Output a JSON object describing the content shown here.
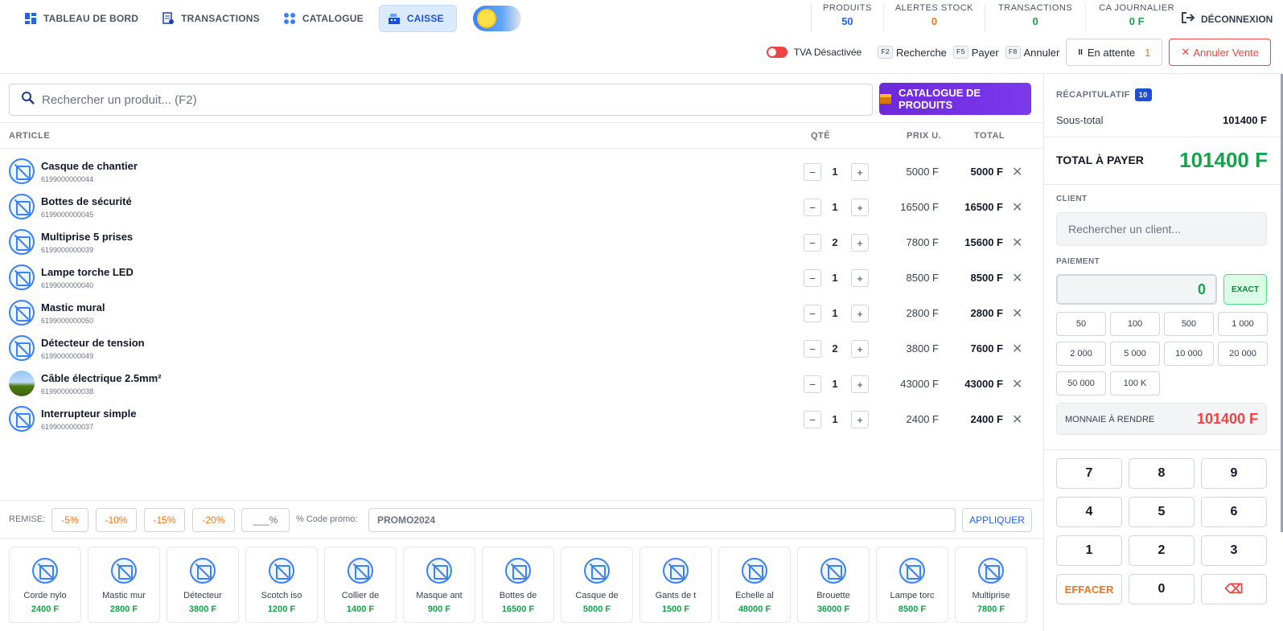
{
  "nav": {
    "items": [
      {
        "label": "TABLEAU DE BORD",
        "icon": "dashboard-icon"
      },
      {
        "label": "TRANSACTIONS",
        "icon": "receipt-icon"
      },
      {
        "label": "CATALOGUE",
        "icon": "grid-icon"
      },
      {
        "label": "CAISSE",
        "icon": "register-icon"
      }
    ]
  },
  "stats": [
    {
      "label": "PRODUITS",
      "value": "50",
      "color": "#2563eb"
    },
    {
      "label": "ALERTES STOCK",
      "value": "0",
      "color": "#f97316"
    },
    {
      "label": "TRANSACTIONS",
      "value": "0",
      "color": "#16a34a"
    },
    {
      "label": "CA JOURNALIER",
      "value": "0 F",
      "color": "#16a34a"
    }
  ],
  "logout_label": "DÉCONNEXION",
  "toolbar": {
    "tva_label": "TVA Désactivée",
    "shortcuts": [
      {
        "key": "F2",
        "label": "Recherche"
      },
      {
        "key": "F5",
        "label": "Payer"
      },
      {
        "key": "F8",
        "label": "Annuler"
      }
    ],
    "wait_label": "En attente",
    "wait_count": "1",
    "cancel_label": "Annuler Vente"
  },
  "search": {
    "placeholder": "Rechercher un produit... (F2)"
  },
  "catalog_button": "CATALOGUE DE PRODUITS",
  "table": {
    "headers": {
      "article": "ARTICLE",
      "qty": "QTÉ",
      "price": "PRIX U.",
      "total": "TOTAL"
    },
    "rows": [
      {
        "name": "Casque de chantier",
        "code": "6199000000044",
        "qty": "1",
        "price": "5000 F",
        "total": "5000 F",
        "photo": false
      },
      {
        "name": "Bottes de sécurité",
        "code": "6199000000045",
        "qty": "1",
        "price": "16500 F",
        "total": "16500 F",
        "photo": false
      },
      {
        "name": "Multiprise 5 prises",
        "code": "6199000000039",
        "qty": "2",
        "price": "7800 F",
        "total": "15600 F",
        "photo": false
      },
      {
        "name": "Lampe torche LED",
        "code": "6199000000040",
        "qty": "1",
        "price": "8500 F",
        "total": "8500 F",
        "photo": false
      },
      {
        "name": "Mastic mural",
        "code": "6199000000050",
        "qty": "1",
        "price": "2800 F",
        "total": "2800 F",
        "photo": false
      },
      {
        "name": "Détecteur de tension",
        "code": "6199000000049",
        "qty": "2",
        "price": "3800 F",
        "total": "7600 F",
        "photo": false
      },
      {
        "name": "Câble électrique 2.5mm²",
        "code": "6199000000038",
        "qty": "1",
        "price": "43000 F",
        "total": "43000 F",
        "photo": true
      },
      {
        "name": "Interrupteur simple",
        "code": "6199000000037",
        "qty": "1",
        "price": "2400 F",
        "total": "2400 F",
        "photo": false
      }
    ]
  },
  "discount": {
    "label": "REMISE:",
    "buttons": [
      "-5%",
      "-10%",
      "-15%",
      "-20%"
    ],
    "custom_placeholder": "___%",
    "promo_label": "% Code promo:",
    "promo_value": "PROMO2024",
    "apply_label": "APPLIQUER"
  },
  "quick_products": [
    {
      "name": "Corde nylo",
      "price": "2400 F"
    },
    {
      "name": "Mastic mur",
      "price": "2800 F"
    },
    {
      "name": "Détecteur",
      "price": "3800 F"
    },
    {
      "name": "Scotch iso",
      "price": "1200 F"
    },
    {
      "name": "Collier de",
      "price": "1400 F"
    },
    {
      "name": "Masque ant",
      "price": "900 F"
    },
    {
      "name": "Bottes de",
      "price": "16500 F"
    },
    {
      "name": "Casque de",
      "price": "5000 F"
    },
    {
      "name": "Gants de t",
      "price": "1500 F"
    },
    {
      "name": "Échelle al",
      "price": "48000 F"
    },
    {
      "name": "Brouette",
      "price": "36000 F"
    },
    {
      "name": "Lampe torc",
      "price": "8500 F"
    },
    {
      "name": "Multiprise",
      "price": "7800 F"
    }
  ],
  "summary": {
    "title": "RÉCAPITULATIF",
    "count": "10",
    "subtotal_label": "Sous-total",
    "subtotal_value": "101400 F",
    "total_label": "TOTAL À PAYER",
    "total_value": "101400 F"
  },
  "client": {
    "label": "CLIENT",
    "placeholder": "Rechercher un client..."
  },
  "payment": {
    "label": "PAIEMENT",
    "value": "0",
    "exact_label": "EXACT",
    "quick_amounts": [
      "50",
      "100",
      "500",
      "1 000",
      "2 000",
      "5 000",
      "10 000",
      "20 000",
      "50 000",
      "100 K"
    ],
    "change_label": "MONNAIE À RENDRE",
    "change_value": "101400 F"
  },
  "keypad": [
    "7",
    "8",
    "9",
    "4",
    "5",
    "6",
    "1",
    "2",
    "3",
    "EFFACER",
    "0",
    "⌫"
  ]
}
